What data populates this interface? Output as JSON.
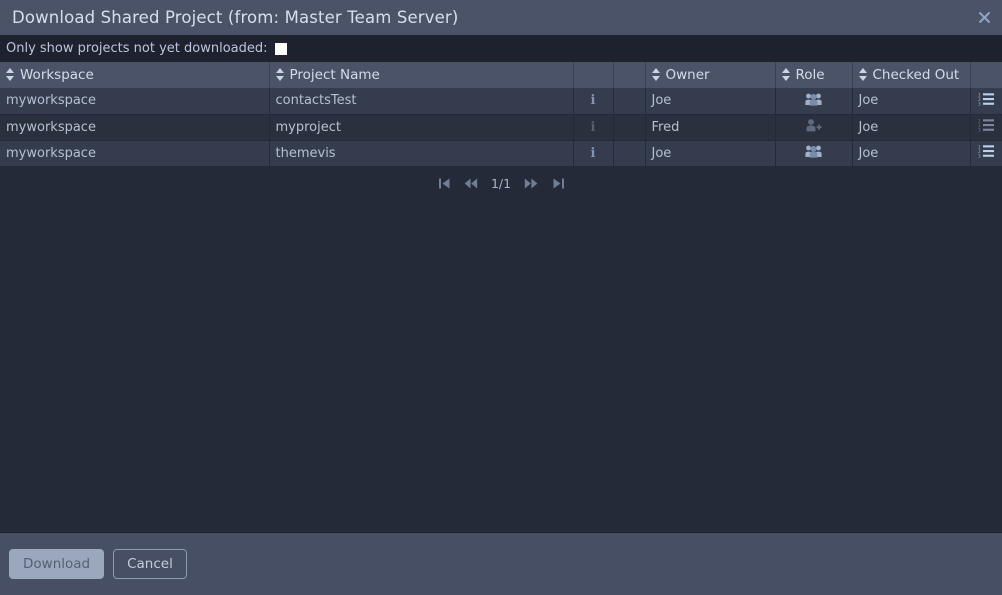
{
  "dialog": {
    "title": "Download Shared Project (from: Master Team Server)",
    "close_icon": "close-icon"
  },
  "filter": {
    "label": "Only show projects not yet downloaded:",
    "checked": false
  },
  "table": {
    "columns": [
      {
        "label": "Workspace",
        "sortable": true
      },
      {
        "label": "Project Name",
        "sortable": true
      },
      {
        "label": "",
        "sortable": false
      },
      {
        "label": "",
        "sortable": false
      },
      {
        "label": "Owner",
        "sortable": true
      },
      {
        "label": "Role",
        "sortable": true
      },
      {
        "label": "Checked Out",
        "sortable": true
      },
      {
        "label": "",
        "sortable": false
      }
    ],
    "rows": [
      {
        "workspace": "myworkspace",
        "project_name": "contactsTest",
        "info": "i",
        "blank": "",
        "owner": "Joe",
        "role_icon": "users-group-icon",
        "checked_out": "Joe",
        "list_icon": "numbered-list-icon",
        "dimmed": false
      },
      {
        "workspace": "myworkspace",
        "project_name": "myproject",
        "info": "i",
        "blank": "",
        "owner": "Fred",
        "role_icon": "user-add-icon",
        "checked_out": "Joe",
        "list_icon": "numbered-list-icon",
        "dimmed": true
      },
      {
        "workspace": "myworkspace",
        "project_name": "themevis",
        "info": "i",
        "blank": "",
        "owner": "Joe",
        "role_icon": "users-group-icon",
        "checked_out": "Joe",
        "list_icon": "numbered-list-icon",
        "dimmed": false
      }
    ]
  },
  "pagination": {
    "first_icon": "first-page-icon",
    "prev_icon": "previous-page-icon",
    "page_label": "1/1",
    "next_icon": "next-page-icon",
    "last_icon": "last-page-icon"
  },
  "footer": {
    "download_label": "Download",
    "download_enabled": false,
    "cancel_label": "Cancel"
  },
  "colors": {
    "window_background": "#252a38",
    "titlebar": "#4a5368",
    "filterbar": "#1e222e",
    "header_row": "#4a5368",
    "row_odd": "#343c4e",
    "row_even": "#2a303d",
    "footer": "#464f63",
    "text_primary": "#b5c0d3",
    "text_dimmed": "#626c80",
    "icon_accent": "#7f93b5"
  }
}
